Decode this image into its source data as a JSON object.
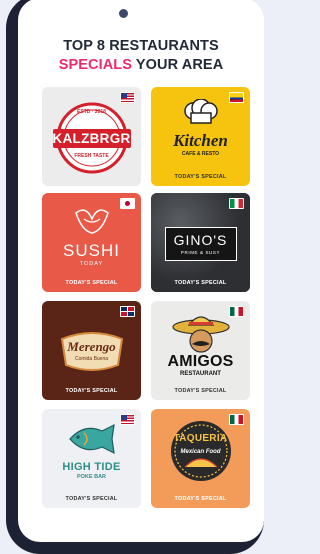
{
  "heading": {
    "line1": "TOP 8 RESTAURANTS",
    "line2_accent": "SPECIALS",
    "line2_rest": " YOUR AREA"
  },
  "colors": {
    "accent": "#ee2a6f",
    "heading": "#222a38",
    "frame": "#1c2233"
  },
  "restaurants": [
    {
      "name": "KALZBRGR",
      "est": "ESTD · 2018",
      "tagline": "FRESH TASTE",
      "flag": "us-flag",
      "special": ""
    },
    {
      "name": "Kitchen",
      "tagline": "CAFE & RESTO",
      "flag": "colombia-flag",
      "special": "TODAY'S SPECIAL"
    },
    {
      "name": "SUSHI",
      "tagline": "TODAY",
      "flag": "japan-flag",
      "special": "TODAY'S SPECIAL"
    },
    {
      "name": "GINO'S",
      "tagline": "PRIME & SUSY",
      "flag": "italy-flag",
      "special": "TODAY'S SPECIAL"
    },
    {
      "name": "Merengo",
      "tagline": "Comida Buena",
      "flag": "dominican-republic-flag",
      "special": "TODAY'S SPECIAL"
    },
    {
      "name": "AMIGOS",
      "tagline": "RESTAURANT",
      "flag": "mexico-flag",
      "special": "TODAY'S SPECIAL"
    },
    {
      "name": "HIGH TIDE",
      "tagline": "POKE BAR",
      "flag": "us-flag",
      "special": "TODAY'S SPECIAL"
    },
    {
      "name": "TAQUERIA",
      "tagline": "Mexican Food",
      "flag": "mexico-flag",
      "special": "TODAY'S SPECIAL"
    }
  ]
}
